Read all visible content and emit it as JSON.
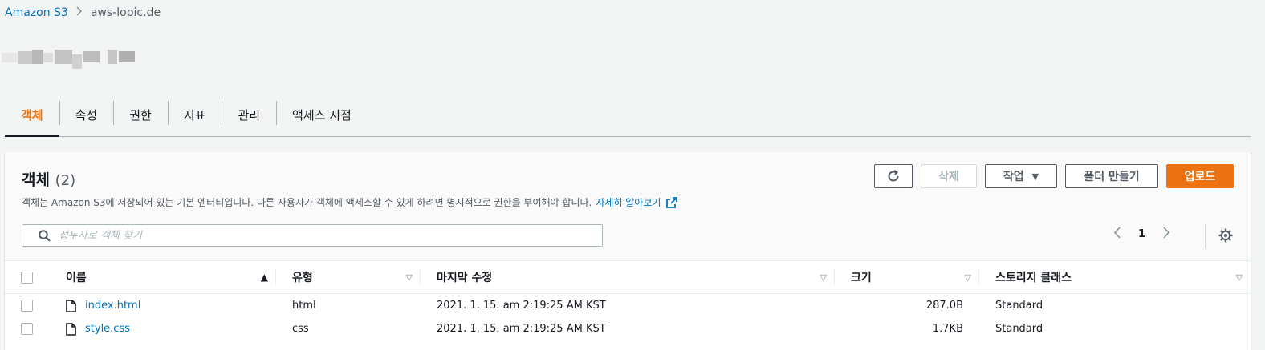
{
  "breadcrumb": {
    "root": "Amazon S3",
    "current": "aws-lopic.de"
  },
  "tabs": [
    "객체",
    "속성",
    "권한",
    "지표",
    "관리",
    "액세스 지점"
  ],
  "panel": {
    "title": "객체",
    "count": "(2)",
    "description": "객체는 Amazon S3에 저장되어 있는 기본 엔터티입니다. 다른 사용자가 객체에 액세스할 수 있게 하려면 명시적으로 권한을 부여해야 합니다.",
    "learn_more": "자세히 알아보기",
    "buttons": {
      "delete": "삭제",
      "actions": "작업",
      "create_folder": "폴더 만들기",
      "upload": "업로드"
    },
    "search_placeholder": "접두사로 객체 찾기",
    "page": "1"
  },
  "table": {
    "headers": {
      "name": "이름",
      "type": "유형",
      "modified": "마지막 수정",
      "size": "크기",
      "storage": "스토리지 클래스"
    },
    "rows": [
      {
        "name": "index.html",
        "type": "html",
        "modified": "2021. 1. 15. am 2:19:25 AM KST",
        "size": "287.0B",
        "storage": "Standard"
      },
      {
        "name": "style.css",
        "type": "css",
        "modified": "2021. 1. 15. am 2:19:25 AM KST",
        "size": "1.7KB",
        "storage": "Standard"
      }
    ]
  },
  "colors": {
    "accent": "#ec7211",
    "link": "#0073bb"
  }
}
